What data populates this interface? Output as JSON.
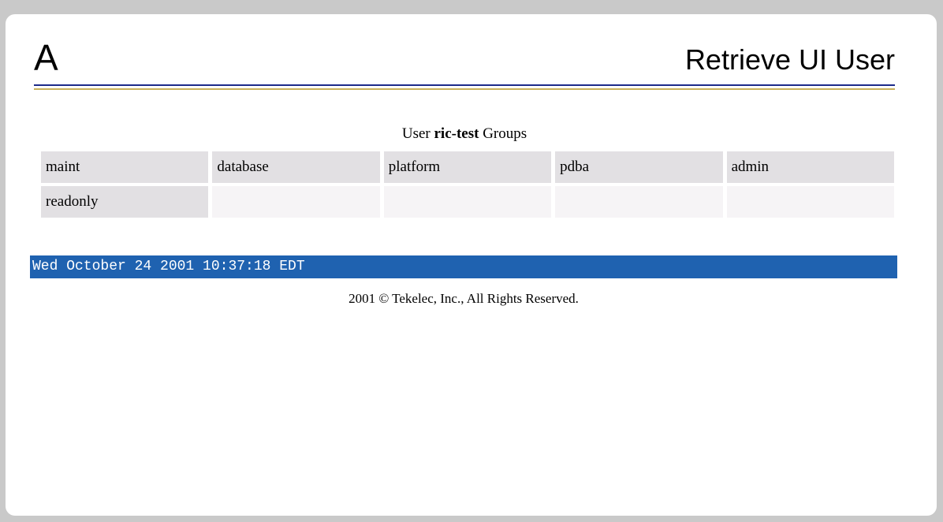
{
  "header": {
    "logo_text": "A",
    "title": "Retrieve UI User"
  },
  "groups": {
    "caption_prefix": "User ",
    "username": "ric-test",
    "caption_suffix": " Groups",
    "rows": [
      [
        "maint",
        "database",
        "platform",
        "pdba",
        "admin"
      ],
      [
        "readonly",
        "",
        "",
        "",
        ""
      ]
    ]
  },
  "status_bar": {
    "datetime": "Wed October 24 2001 10:37:18 EDT"
  },
  "footer": {
    "copyright": "2001 © Tekelec, Inc., All Rights Reserved."
  },
  "colors": {
    "status_bar_bg": "#1f62b0",
    "rule_blue": "#1c2b8a",
    "rule_gold": "#c9b15a"
  }
}
